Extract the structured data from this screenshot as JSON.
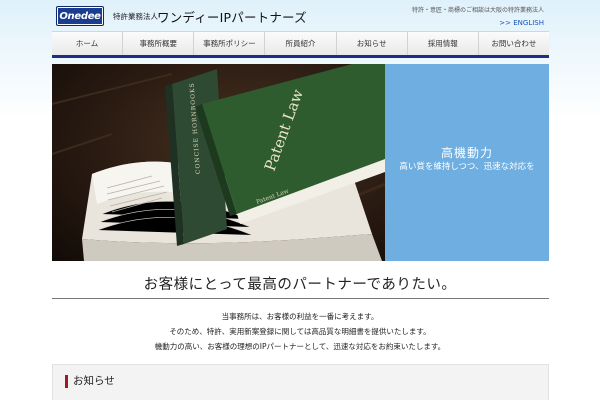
{
  "header": {
    "logo_text": "Onedee",
    "corp_type": "特許業務法人",
    "firm_name": "ワンディーIPパートナーズ",
    "tagline": "特許・意匠・商標のご相談は大阪の特許業務法人",
    "english_link": ">> ENGLISH"
  },
  "nav": {
    "items": [
      {
        "label": "ホーム"
      },
      {
        "label": "事務所概要"
      },
      {
        "label": "事務所ポリシー"
      },
      {
        "label": "所員紹介"
      },
      {
        "label": "お知らせ"
      },
      {
        "label": "採用情報"
      },
      {
        "label": "お問い合わせ"
      }
    ]
  },
  "hero": {
    "book_title": "Patent Law",
    "book_spine": "CONCISE HORNBOOKS",
    "book_caption": "Patent Law",
    "title": "高機動力",
    "subtitle": "高い質を維持しつつ、迅速な対応を"
  },
  "main": {
    "headline": "お客様にとって最高のパートナーでありたい。",
    "intro": [
      "当事務所は、お客様の利益を一番に考えます。",
      "そのため、特許、実用新案登録に関しては高品質な明細書を提供いたします。",
      "機動力の高い、お客様の理想のIPパートナーとして、迅速な対応をお約束いたします。"
    ]
  },
  "news": {
    "heading": "お知らせ"
  },
  "colors": {
    "accent_navy": "#1e2e86",
    "hero_blue": "#6eaee0",
    "news_marker": "#9b1b2a",
    "link_blue": "#1a56b8"
  }
}
